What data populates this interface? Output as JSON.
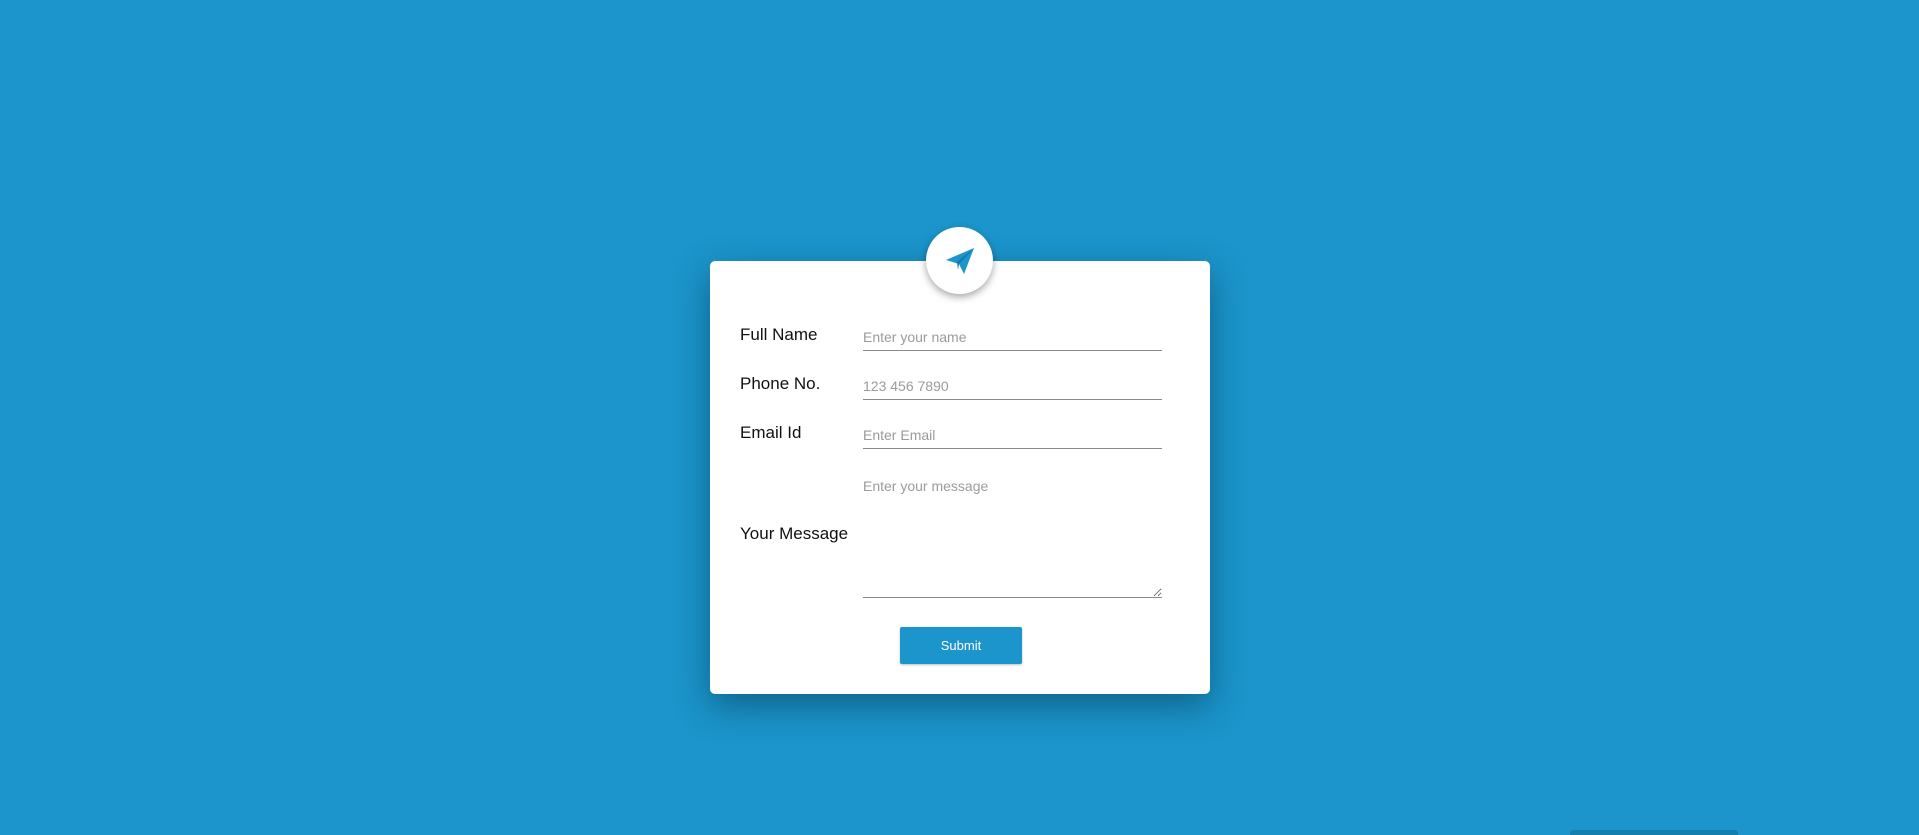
{
  "form": {
    "icon": "paper-plane-icon",
    "fields": {
      "full_name": {
        "label": "Full Name",
        "placeholder": "Enter your name",
        "value": ""
      },
      "phone": {
        "label": "Phone No.",
        "placeholder": "123 456 7890",
        "value": ""
      },
      "email": {
        "label": "Email Id",
        "placeholder": "Enter Email",
        "value": ""
      },
      "message": {
        "label": "Your Message",
        "placeholder": "Enter your message",
        "value": ""
      }
    },
    "submit_label": "Submit"
  },
  "colors": {
    "background": "#1b95cb",
    "card": "#ffffff",
    "accent": "#1b95cb"
  }
}
